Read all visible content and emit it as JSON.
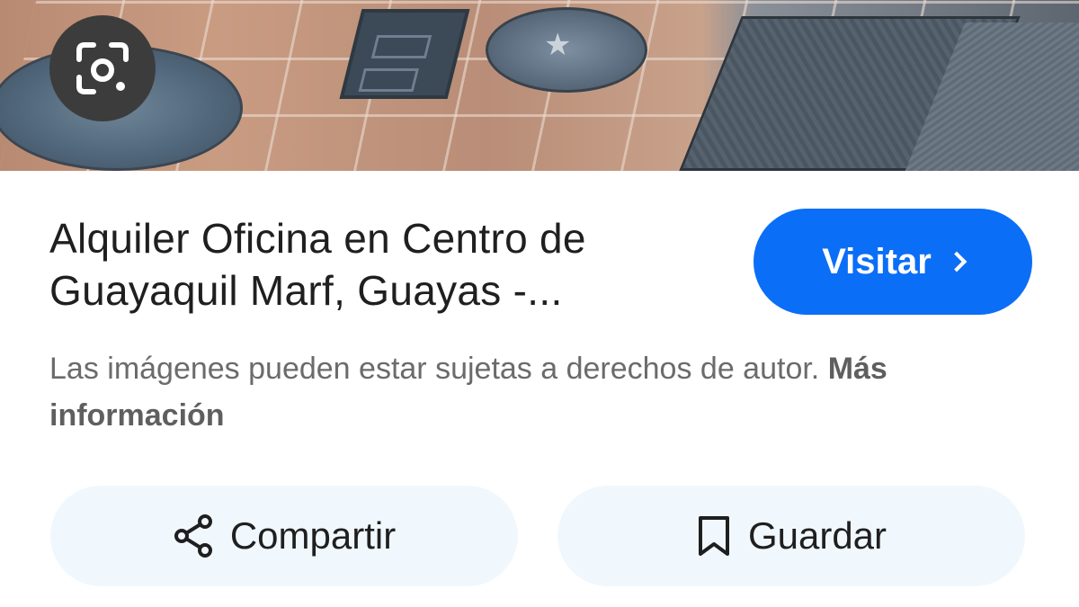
{
  "result": {
    "title": "Alquiler Oficina en Centro de Guayaquil Marf, Guayas -...",
    "visit_label": "Visitar",
    "notice_text": "Las imágenes pueden estar sujetas a derechos de autor.",
    "more_info_label": "Más información"
  },
  "actions": {
    "share_label": "Compartir",
    "save_label": "Guardar"
  },
  "icons": {
    "lens": "google-lens-icon",
    "visit": "chevron-right-icon",
    "share": "share-icon",
    "save": "bookmark-icon"
  },
  "colors": {
    "accent": "#0b6ef6",
    "action_bg": "#f1f8fd",
    "lens_bg": "#3c3c3c"
  }
}
